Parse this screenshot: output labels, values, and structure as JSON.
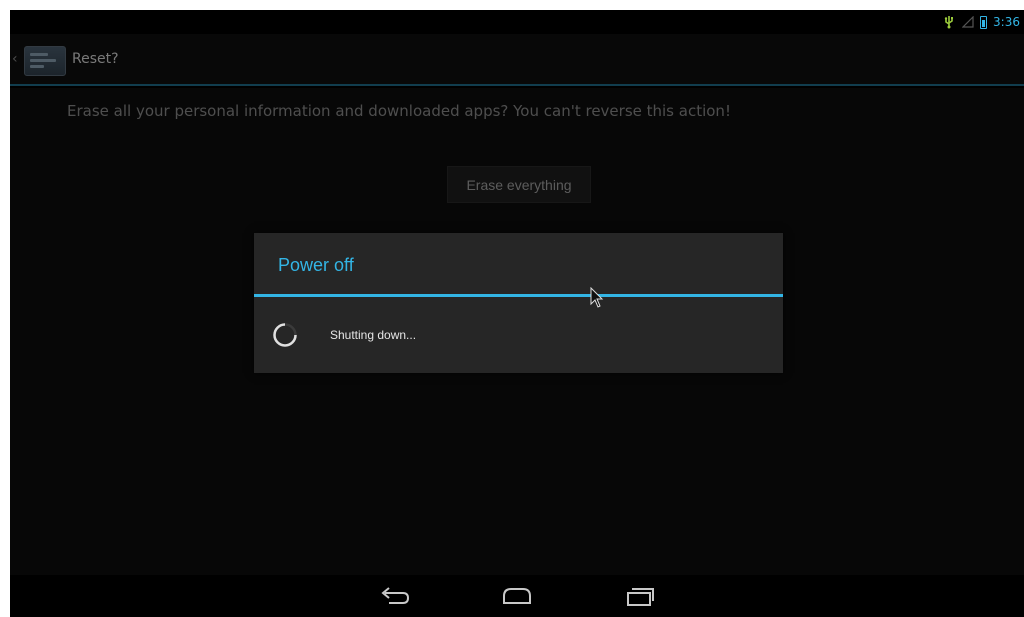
{
  "status_bar": {
    "time": "3:36",
    "icons": [
      "usb-icon",
      "signal-icon",
      "battery-icon"
    ],
    "accent_color": "#33b5e5"
  },
  "action_bar": {
    "title": "Reset?",
    "icon": "settings-app-icon"
  },
  "content": {
    "warning_text": "Erase all your personal information and downloaded apps? You can't reverse this action!",
    "erase_button_label": "Erase everything"
  },
  "dialog": {
    "title": "Power off",
    "message": "Shutting down...",
    "accent_color": "#33b5e5"
  },
  "nav_bar": {
    "buttons": [
      "back-icon",
      "home-icon",
      "recent-apps-icon"
    ]
  }
}
